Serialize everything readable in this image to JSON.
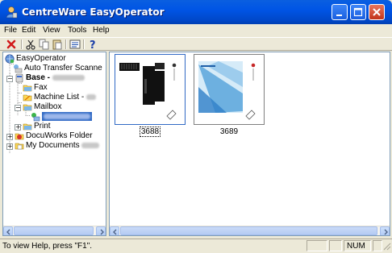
{
  "window": {
    "title": "CentreWare EasyOperator"
  },
  "menu": [
    {
      "label": "File"
    },
    {
      "label": "Edit"
    },
    {
      "label": "View"
    },
    {
      "label": "Tools"
    },
    {
      "label": "Help"
    }
  ],
  "toolbar": {
    "tools": [
      "delete-icon",
      "cut-icon",
      "copy-icon",
      "paste-icon",
      "properties-icon",
      "help-icon"
    ]
  },
  "tree": {
    "root": "EasyOperator",
    "auto_transfer": "Auto Transfer Scanne",
    "base": "Base -",
    "fax": "Fax",
    "machine_list": "Machine List -",
    "mailbox": "Mailbox",
    "print": "Print",
    "docuworks": "DocuWorks Folder",
    "my_documents": "My Documents"
  },
  "thumbnails": [
    {
      "label": "3688",
      "selected": true
    },
    {
      "label": "3689",
      "selected": false
    }
  ],
  "status": {
    "help_text": "To view Help, press \"F1\".",
    "num": "NUM"
  },
  "colors": {
    "titlebar": "#0055e5",
    "selection": "#316ac5",
    "window_bg": "#ece9d8"
  }
}
